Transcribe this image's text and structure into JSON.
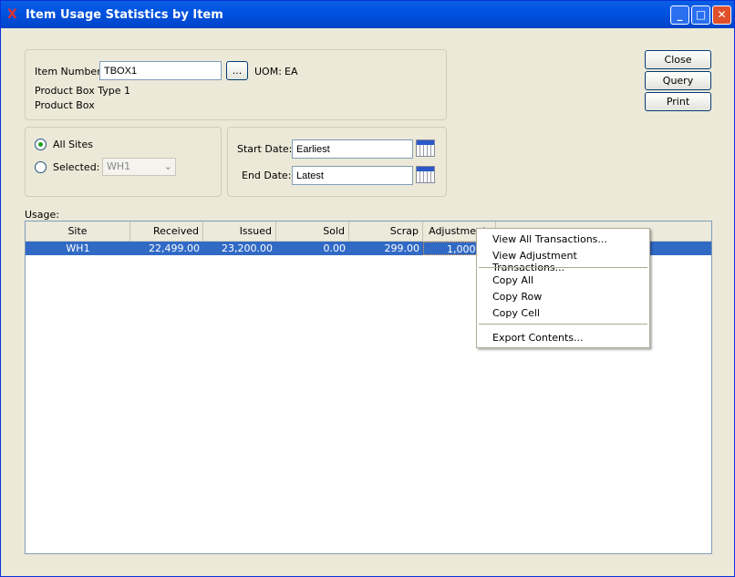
{
  "window": {
    "title": "Item Usage Statistics by Item",
    "logo": "X"
  },
  "item": {
    "label": "Item Number:",
    "value": "TBOX1",
    "lookup": "...",
    "uom_label": "UOM:",
    "uom": "EA",
    "desc1": "Product Box Type 1",
    "desc2": "Product Box"
  },
  "sites": {
    "all": "All Sites",
    "selected": "Selected:",
    "selected_value": "WH1",
    "all_checked": true
  },
  "dates": {
    "start_label": "Start Date:",
    "start": "Earliest",
    "end_label": "End Date:",
    "end": "Latest"
  },
  "buttons": {
    "close": "Close",
    "query": "Query",
    "print": "Print"
  },
  "usage": {
    "label": "Usage:",
    "columns": [
      "Site",
      "Received",
      "Issued",
      "Sold",
      "Scrap",
      "Adjustments"
    ],
    "rows": [
      {
        "site": "WH1",
        "received": "22,499.00",
        "issued": "23,200.00",
        "sold": "0.00",
        "scrap": "299.00",
        "adjustments": "1,000.00"
      }
    ]
  },
  "menu": {
    "items": [
      "View All Transactions...",
      "View Adjustment Transactions...",
      "Copy All",
      "Copy Row",
      "Copy Cell",
      "Export Contents..."
    ]
  }
}
